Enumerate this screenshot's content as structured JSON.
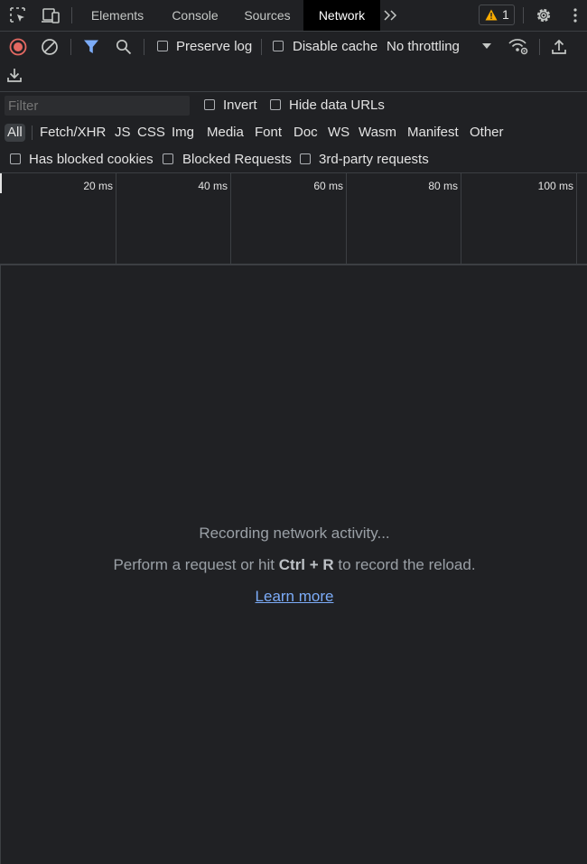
{
  "toolbar": {
    "tabs": [
      {
        "label": "Elements"
      },
      {
        "label": "Console"
      },
      {
        "label": "Sources"
      },
      {
        "label": "Network"
      }
    ],
    "warning_count": "1",
    "colors": {
      "warning": "#f9ab00",
      "record": "#e46962",
      "accent": "#7cacf8"
    }
  },
  "network_toolbar": {
    "preserve_log": "Preserve log",
    "disable_cache": "Disable cache",
    "throttling": "No throttling"
  },
  "filter_bar": {
    "placeholder": "Filter",
    "invert": "Invert",
    "hide_data_urls": "Hide data URLs"
  },
  "type_filters": [
    "All",
    "Fetch/XHR",
    "JS",
    "CSS",
    "Img",
    "Media",
    "Font",
    "Doc",
    "WS",
    "Wasm",
    "Manifest",
    "Other"
  ],
  "request_filters": {
    "blocked_cookies": "Has blocked cookies",
    "blocked_requests": "Blocked Requests",
    "third_party": "3rd-party requests"
  },
  "timeline": {
    "ticks": [
      "20 ms",
      "40 ms",
      "60 ms",
      "80 ms",
      "100 ms"
    ]
  },
  "empty_state": {
    "title": "Recording network activity...",
    "hint_prefix": "Perform a request or hit ",
    "shortcut": "Ctrl + R",
    "hint_suffix": " to record the reload.",
    "learn_more": "Learn more"
  }
}
